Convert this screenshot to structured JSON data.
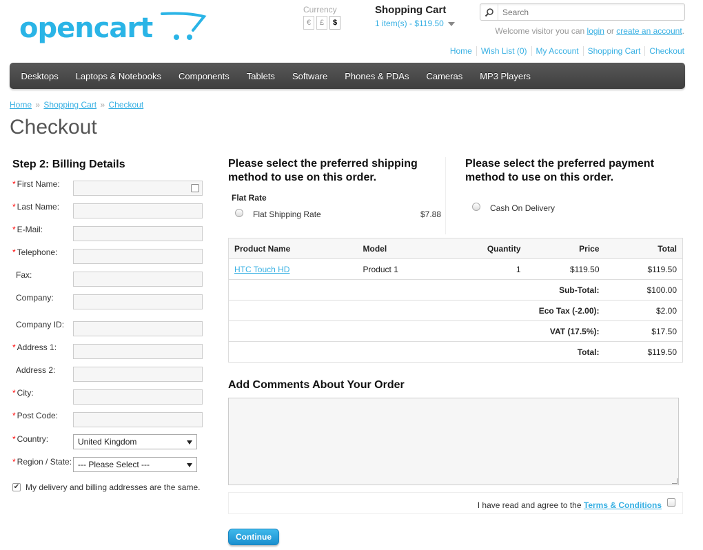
{
  "header": {
    "logo_text": "opencart",
    "currency": {
      "label": "Currency",
      "options": [
        "€",
        "£",
        "$"
      ],
      "selected": "$"
    },
    "cart": {
      "title": "Shopping Cart",
      "summary": "1 item(s) - $119.50"
    },
    "search": {
      "placeholder": "Search"
    },
    "welcome": {
      "prefix": "Welcome visitor you can",
      "login": "login",
      "or": "or",
      "create": "create an account",
      "suffix": "."
    },
    "top_links": [
      "Home",
      "Wish List (0)",
      "My Account",
      "Shopping Cart",
      "Checkout"
    ]
  },
  "menu": [
    "Desktops",
    "Laptops & Notebooks",
    "Components",
    "Tablets",
    "Software",
    "Phones & PDAs",
    "Cameras",
    "MP3 Players"
  ],
  "breadcrumb": {
    "items": [
      "Home",
      "Shopping Cart",
      "Checkout"
    ],
    "separator": "»"
  },
  "page_title": "Checkout",
  "billing": {
    "heading": "Step 2: Billing Details",
    "fields": [
      {
        "label": "First Name:",
        "required": true,
        "value": ""
      },
      {
        "label": "Last Name:",
        "required": true,
        "value": ""
      },
      {
        "label": "E-Mail:",
        "required": true,
        "value": ""
      },
      {
        "label": "Telephone:",
        "required": true,
        "value": ""
      },
      {
        "label": "Fax:",
        "required": false,
        "value": ""
      },
      {
        "label": "Company:",
        "required": false,
        "value": ""
      },
      {
        "label": "Company ID:",
        "required": false,
        "value": ""
      },
      {
        "label": "Address 1:",
        "required": true,
        "value": ""
      },
      {
        "label": "Address 2:",
        "required": false,
        "value": ""
      },
      {
        "label": "City:",
        "required": true,
        "value": ""
      },
      {
        "label": "Post Code:",
        "required": true,
        "value": ""
      }
    ],
    "country": {
      "label": "Country:",
      "value": "United Kingdom"
    },
    "region": {
      "label": "Region / State:",
      "value": "--- Please Select ---"
    },
    "same_address": {
      "label": "My delivery and billing addresses are the same.",
      "checked": true
    }
  },
  "shipping": {
    "heading": "Please select the preferred shipping method to use on this order.",
    "group_title": "Flat Rate",
    "option_label": "Flat Shipping Rate",
    "option_price": "$7.88"
  },
  "payment": {
    "heading": "Please select the preferred payment method to use on this order.",
    "option_label": "Cash On Delivery"
  },
  "order": {
    "columns": [
      "Product Name",
      "Model",
      "Quantity",
      "Price",
      "Total"
    ],
    "products": [
      {
        "name": "HTC Touch HD",
        "model": "Product 1",
        "quantity": "1",
        "price": "$119.50",
        "total": "$119.50"
      }
    ],
    "totals": [
      {
        "label": "Sub-Total:",
        "value": "$100.00"
      },
      {
        "label": "Eco Tax (-2.00):",
        "value": "$2.00"
      },
      {
        "label": "VAT (17.5%):",
        "value": "$17.50"
      },
      {
        "label": "Total:",
        "value": "$119.50"
      }
    ]
  },
  "comments": {
    "heading": "Add Comments About Your Order",
    "value": ""
  },
  "agree": {
    "prefix": "I have read and agree to the",
    "link": "Terms & Conditions",
    "checked": false
  },
  "continue_label": "Continue",
  "colors": {
    "accent": "#38b0e3",
    "menu_bg": "#4a4a4a",
    "required": "#ff0000"
  }
}
